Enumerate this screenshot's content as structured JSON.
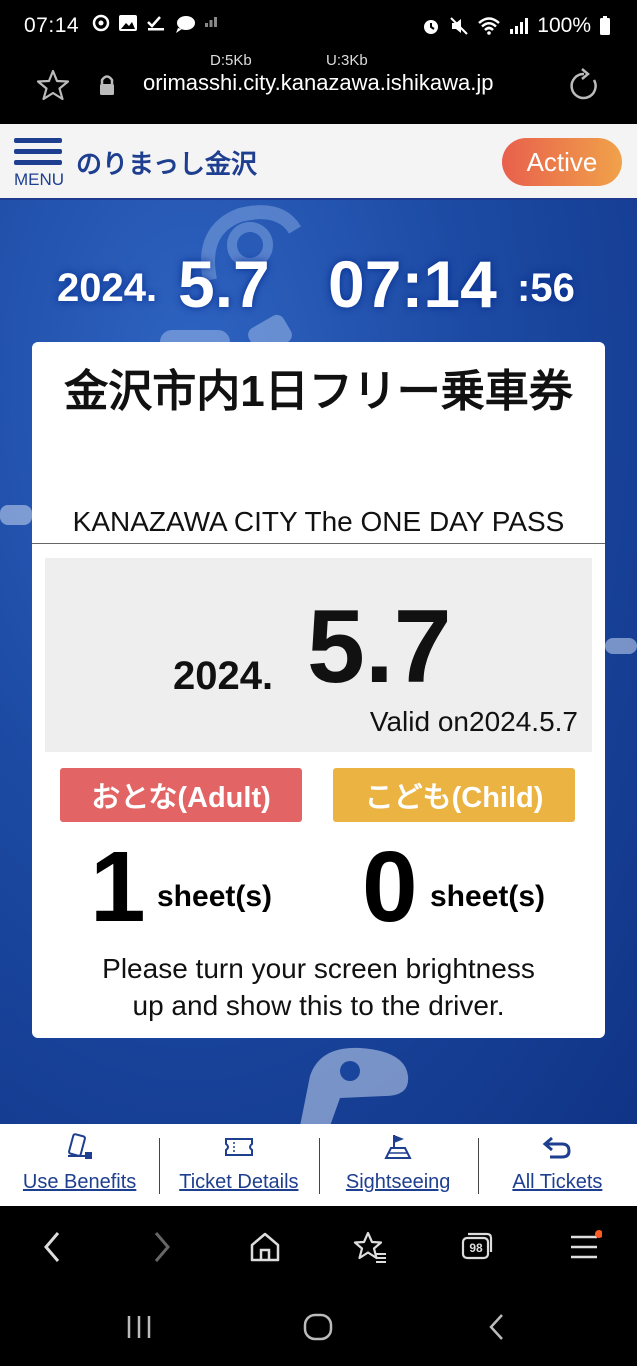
{
  "status_bar": {
    "time": "07:14",
    "battery": "100%"
  },
  "browser": {
    "net_down": "D:5Kb",
    "net_up": "U:3Kb",
    "url": "orimasshi.city.kanazawa.ishikawa.jp",
    "tab_count": "98"
  },
  "app_header": {
    "menu_label": "MENU",
    "title": "のりまっし金沢",
    "status_badge": "Active",
    "badge_colors": [
      "#e8604c",
      "#f0a24a"
    ]
  },
  "clock": {
    "year": "2024.",
    "month_day": "5.7",
    "hour_minute": "07:14",
    "seconds": ":56"
  },
  "ticket": {
    "title": "金沢市内1日フリー乗車券",
    "subtitle": "KANAZAWA CITY The ONE DAY PASS",
    "date_year": "2024.",
    "date_month_day": "5.7",
    "valid_text": "Valid on2024.5.7",
    "adult_label": "おとな(Adult)",
    "child_label": "こども(Child)",
    "adult_count": "1",
    "child_count": "0",
    "unit": "sheet(s)",
    "instruction_line1": "Please turn your screen brightness",
    "instruction_line2": "up and show this to the driver.",
    "adult_color": "#e26464",
    "child_color": "#eab342"
  },
  "bottom_nav": {
    "items": [
      {
        "label": "Use Benefits",
        "icon": "benefits-icon"
      },
      {
        "label": "Ticket Details",
        "icon": "ticket-icon"
      },
      {
        "label": "Sightseeing",
        "icon": "map-flag-icon"
      },
      {
        "label": "All Tickets",
        "icon": "return-arrow-icon"
      }
    ]
  },
  "colors": {
    "brand_blue": "#1e3f8f",
    "background_blue": "#1c4aa3"
  }
}
